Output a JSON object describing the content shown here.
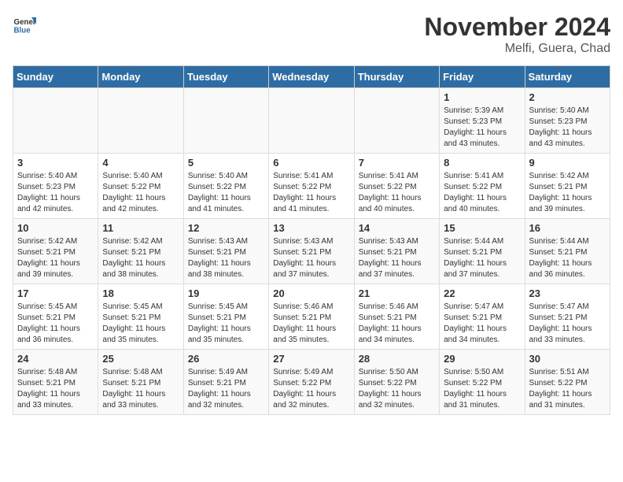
{
  "header": {
    "logo_line1": "General",
    "logo_line2": "Blue",
    "month_title": "November 2024",
    "location": "Melfi, Guera, Chad"
  },
  "days_of_week": [
    "Sunday",
    "Monday",
    "Tuesday",
    "Wednesday",
    "Thursday",
    "Friday",
    "Saturday"
  ],
  "weeks": [
    [
      {
        "day": "",
        "sunrise": "",
        "sunset": "",
        "daylight": ""
      },
      {
        "day": "",
        "sunrise": "",
        "sunset": "",
        "daylight": ""
      },
      {
        "day": "",
        "sunrise": "",
        "sunset": "",
        "daylight": ""
      },
      {
        "day": "",
        "sunrise": "",
        "sunset": "",
        "daylight": ""
      },
      {
        "day": "",
        "sunrise": "",
        "sunset": "",
        "daylight": ""
      },
      {
        "day": "1",
        "sunrise": "Sunrise: 5:39 AM",
        "sunset": "Sunset: 5:23 PM",
        "daylight": "Daylight: 11 hours and 43 minutes."
      },
      {
        "day": "2",
        "sunrise": "Sunrise: 5:40 AM",
        "sunset": "Sunset: 5:23 PM",
        "daylight": "Daylight: 11 hours and 43 minutes."
      }
    ],
    [
      {
        "day": "3",
        "sunrise": "Sunrise: 5:40 AM",
        "sunset": "Sunset: 5:23 PM",
        "daylight": "Daylight: 11 hours and 42 minutes."
      },
      {
        "day": "4",
        "sunrise": "Sunrise: 5:40 AM",
        "sunset": "Sunset: 5:22 PM",
        "daylight": "Daylight: 11 hours and 42 minutes."
      },
      {
        "day": "5",
        "sunrise": "Sunrise: 5:40 AM",
        "sunset": "Sunset: 5:22 PM",
        "daylight": "Daylight: 11 hours and 41 minutes."
      },
      {
        "day": "6",
        "sunrise": "Sunrise: 5:41 AM",
        "sunset": "Sunset: 5:22 PM",
        "daylight": "Daylight: 11 hours and 41 minutes."
      },
      {
        "day": "7",
        "sunrise": "Sunrise: 5:41 AM",
        "sunset": "Sunset: 5:22 PM",
        "daylight": "Daylight: 11 hours and 40 minutes."
      },
      {
        "day": "8",
        "sunrise": "Sunrise: 5:41 AM",
        "sunset": "Sunset: 5:22 PM",
        "daylight": "Daylight: 11 hours and 40 minutes."
      },
      {
        "day": "9",
        "sunrise": "Sunrise: 5:42 AM",
        "sunset": "Sunset: 5:21 PM",
        "daylight": "Daylight: 11 hours and 39 minutes."
      }
    ],
    [
      {
        "day": "10",
        "sunrise": "Sunrise: 5:42 AM",
        "sunset": "Sunset: 5:21 PM",
        "daylight": "Daylight: 11 hours and 39 minutes."
      },
      {
        "day": "11",
        "sunrise": "Sunrise: 5:42 AM",
        "sunset": "Sunset: 5:21 PM",
        "daylight": "Daylight: 11 hours and 38 minutes."
      },
      {
        "day": "12",
        "sunrise": "Sunrise: 5:43 AM",
        "sunset": "Sunset: 5:21 PM",
        "daylight": "Daylight: 11 hours and 38 minutes."
      },
      {
        "day": "13",
        "sunrise": "Sunrise: 5:43 AM",
        "sunset": "Sunset: 5:21 PM",
        "daylight": "Daylight: 11 hours and 37 minutes."
      },
      {
        "day": "14",
        "sunrise": "Sunrise: 5:43 AM",
        "sunset": "Sunset: 5:21 PM",
        "daylight": "Daylight: 11 hours and 37 minutes."
      },
      {
        "day": "15",
        "sunrise": "Sunrise: 5:44 AM",
        "sunset": "Sunset: 5:21 PM",
        "daylight": "Daylight: 11 hours and 37 minutes."
      },
      {
        "day": "16",
        "sunrise": "Sunrise: 5:44 AM",
        "sunset": "Sunset: 5:21 PM",
        "daylight": "Daylight: 11 hours and 36 minutes."
      }
    ],
    [
      {
        "day": "17",
        "sunrise": "Sunrise: 5:45 AM",
        "sunset": "Sunset: 5:21 PM",
        "daylight": "Daylight: 11 hours and 36 minutes."
      },
      {
        "day": "18",
        "sunrise": "Sunrise: 5:45 AM",
        "sunset": "Sunset: 5:21 PM",
        "daylight": "Daylight: 11 hours and 35 minutes."
      },
      {
        "day": "19",
        "sunrise": "Sunrise: 5:45 AM",
        "sunset": "Sunset: 5:21 PM",
        "daylight": "Daylight: 11 hours and 35 minutes."
      },
      {
        "day": "20",
        "sunrise": "Sunrise: 5:46 AM",
        "sunset": "Sunset: 5:21 PM",
        "daylight": "Daylight: 11 hours and 35 minutes."
      },
      {
        "day": "21",
        "sunrise": "Sunrise: 5:46 AM",
        "sunset": "Sunset: 5:21 PM",
        "daylight": "Daylight: 11 hours and 34 minutes."
      },
      {
        "day": "22",
        "sunrise": "Sunrise: 5:47 AM",
        "sunset": "Sunset: 5:21 PM",
        "daylight": "Daylight: 11 hours and 34 minutes."
      },
      {
        "day": "23",
        "sunrise": "Sunrise: 5:47 AM",
        "sunset": "Sunset: 5:21 PM",
        "daylight": "Daylight: 11 hours and 33 minutes."
      }
    ],
    [
      {
        "day": "24",
        "sunrise": "Sunrise: 5:48 AM",
        "sunset": "Sunset: 5:21 PM",
        "daylight": "Daylight: 11 hours and 33 minutes."
      },
      {
        "day": "25",
        "sunrise": "Sunrise: 5:48 AM",
        "sunset": "Sunset: 5:21 PM",
        "daylight": "Daylight: 11 hours and 33 minutes."
      },
      {
        "day": "26",
        "sunrise": "Sunrise: 5:49 AM",
        "sunset": "Sunset: 5:21 PM",
        "daylight": "Daylight: 11 hours and 32 minutes."
      },
      {
        "day": "27",
        "sunrise": "Sunrise: 5:49 AM",
        "sunset": "Sunset: 5:22 PM",
        "daylight": "Daylight: 11 hours and 32 minutes."
      },
      {
        "day": "28",
        "sunrise": "Sunrise: 5:50 AM",
        "sunset": "Sunset: 5:22 PM",
        "daylight": "Daylight: 11 hours and 32 minutes."
      },
      {
        "day": "29",
        "sunrise": "Sunrise: 5:50 AM",
        "sunset": "Sunset: 5:22 PM",
        "daylight": "Daylight: 11 hours and 31 minutes."
      },
      {
        "day": "30",
        "sunrise": "Sunrise: 5:51 AM",
        "sunset": "Sunset: 5:22 PM",
        "daylight": "Daylight: 11 hours and 31 minutes."
      }
    ]
  ]
}
